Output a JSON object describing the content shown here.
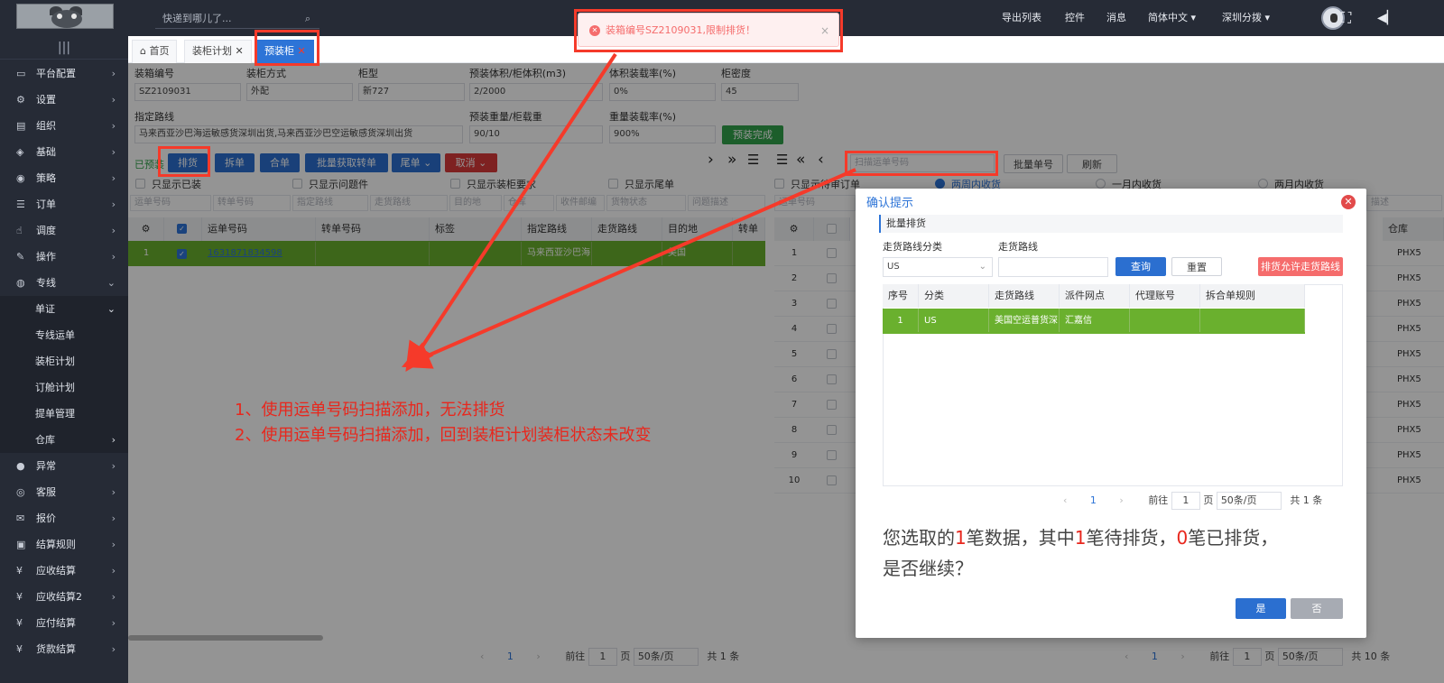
{
  "header": {
    "search_placeholder": "快递到哪儿了...",
    "nav": [
      "导出列表",
      "控件",
      "消息",
      "简体中文",
      "深圳分拨"
    ]
  },
  "sidebar": {
    "toggle": "|||",
    "items": [
      "平台配置",
      "设置",
      "组织",
      "基础",
      "策略",
      "订单",
      "调度",
      "操作",
      "专线",
      "单证",
      "专线运单",
      "装柜计划",
      "订舱计划",
      "提单管理",
      "仓库",
      "异常",
      "客服",
      "报价",
      "结算规则",
      "应收结算",
      "应收结算2",
      "应付结算",
      "货款结算"
    ]
  },
  "tabs": [
    "首页",
    "装柜计划",
    "预装柜"
  ],
  "form": {
    "labels": [
      "装箱编号",
      "装柜方式",
      "柜型",
      "预装体积/柜体积(m3)",
      "体积装载率(%)",
      "柜密度",
      "指定路线",
      "预装重量/柜载重",
      "重量装载率(%)"
    ],
    "values": [
      "SZ2109031",
      "外配",
      "新727",
      "2/2000",
      "0%",
      "45",
      "马来西亚沙巴海运敏感货深圳出货,马来西亚沙巴空运敏感货深圳出货",
      "90/10",
      "900%"
    ],
    "complete_button": "预装完成"
  },
  "left_toolbar": {
    "status": "已预装",
    "buttons": [
      "排货",
      "拆单",
      "合单",
      "批量获取转单",
      "尾单",
      "取消"
    ]
  },
  "right_toolbar": {
    "scan_placeholder": "扫描运单号码",
    "batch_button": "批量单号",
    "refresh_button": "刷新"
  },
  "left_checks": [
    "只显示已装",
    "只显示问题件",
    "只显示装柜要求",
    "只显示尾单"
  ],
  "right_checks": [
    "只显示待审订单",
    "两周内收货",
    "一月内收货",
    "两月内收货"
  ],
  "left_filters": [
    "运单号码",
    "转单号码",
    "指定路线",
    "走货路线",
    "目的地",
    "仓库",
    "收件邮编",
    "货物状态",
    "问题描述"
  ],
  "right_filters": [
    "运单号码",
    "描述"
  ],
  "left_table": {
    "headers": [
      "运单号码",
      "转单号码",
      "标签",
      "指定路线",
      "走货路线",
      "目的地",
      "转单"
    ],
    "row": {
      "index": "1",
      "tracking": "1631871834598",
      "route": "马来西亚沙巴海",
      "dest": "美国"
    }
  },
  "right_table": {
    "header_last": "仓库",
    "rows": [
      "1",
      "2",
      "3",
      "4",
      "5",
      "6",
      "7",
      "8",
      "9",
      "10"
    ],
    "last_col": "PHX5"
  },
  "left_pager": {
    "page": "1",
    "goto_label": "前往",
    "goto": "1",
    "page_unit": "页",
    "size": "50条/页",
    "total": "共 1 条"
  },
  "right_pager": {
    "page": "1",
    "goto_label": "前往",
    "goto": "1",
    "page_unit": "页",
    "size": "50条/页",
    "total": "共 10 条"
  },
  "alert": {
    "message": "装箱编号SZ2109031,限制排货！",
    "close": "×"
  },
  "dialog": {
    "title": "确认提示",
    "section": "批量排货",
    "route_category_label": "走货路线分类",
    "route_category_value": "US",
    "route_label": "走货路线",
    "query_button": "查询",
    "reset_button": "重置",
    "allow_button": "排货允许走货路线",
    "table_headers": [
      "序号",
      "分类",
      "走货路线",
      "派件网点",
      "代理账号",
      "拆合单规则"
    ],
    "table_row": [
      "1",
      "US",
      "美国空运普货深",
      "汇嘉信",
      "",
      ""
    ],
    "pager": {
      "page": "1",
      "goto_label": "前往",
      "goto": "1",
      "page_unit": "页",
      "size": "50条/页",
      "total": "共 1 条"
    },
    "message_parts": [
      "您选取的",
      "1",
      "笔数据，其中",
      "1",
      "笔待排货，",
      "0",
      "笔已排货，",
      "是否继续？"
    ],
    "yes": "是",
    "no": "否"
  },
  "annotations": [
    "1、使用运单号码扫描添加，无法排货",
    "2、使用运单号码扫描添加，回到装柜计划装柜状态未改变"
  ],
  "colors": {
    "sidebar": "#262b36",
    "accent": "#2d74d7",
    "row_selected": "#6ab02e",
    "annotation": "#f53a2a"
  }
}
